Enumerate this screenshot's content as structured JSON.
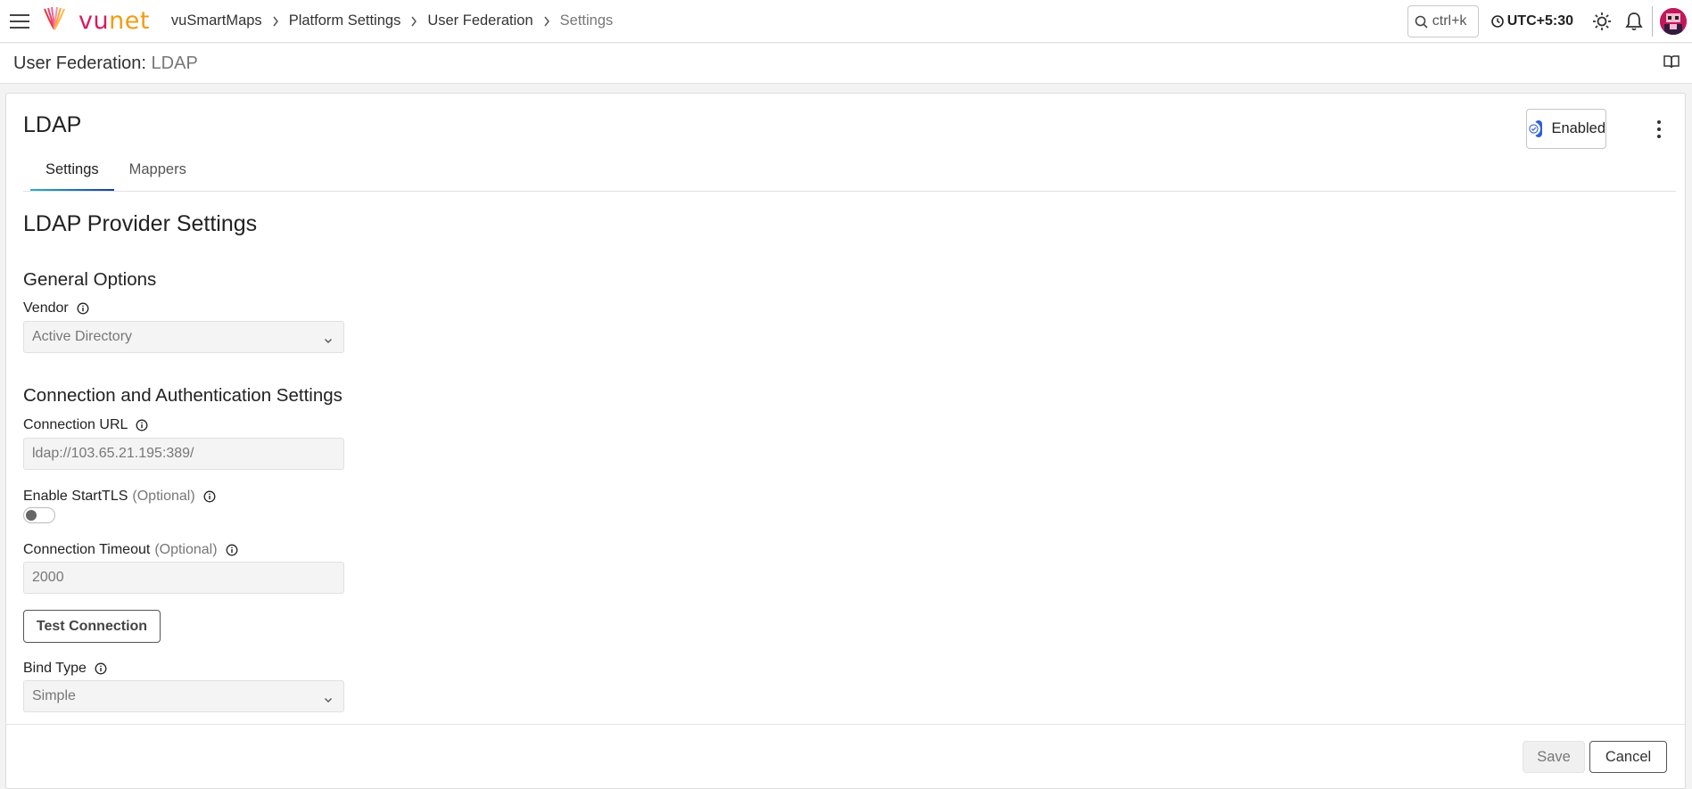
{
  "header": {
    "logo_vu": "vu",
    "logo_net": "net",
    "breadcrumb": [
      "vuSmartMaps",
      "Platform Settings",
      "User Federation",
      "Settings"
    ],
    "search_placeholder": "ctrl+k",
    "timezone": "UTC+5:30",
    "icons": [
      "hamburger-icon",
      "vunet-logo-icon",
      "search-icon",
      "clock-icon",
      "sun-icon",
      "bell-icon",
      "avatar-icon",
      "book-icon"
    ]
  },
  "page": {
    "title_prefix": "User Federation:",
    "title_value": "LDAP"
  },
  "card": {
    "title": "LDAP",
    "status_label": "Enabled",
    "status_enabled": true,
    "tabs": [
      {
        "label": "Settings",
        "active": true
      },
      {
        "label": "Mappers",
        "active": false
      }
    ]
  },
  "form": {
    "heading": "LDAP Provider Settings",
    "general_heading": "General Options",
    "vendor_label": "Vendor",
    "vendor_value": "Active Directory",
    "connection_heading": "Connection and Authentication Settings",
    "connection_url_label": "Connection URL",
    "connection_url_value": "ldap://103.65.21.195:389/",
    "starttls_label": "Enable StartTLS",
    "starttls_optional": "(Optional)",
    "starttls_enabled": false,
    "timeout_label": "Connection Timeout",
    "timeout_optional": "(Optional)",
    "timeout_value": "2000",
    "test_button": "Test Connection",
    "bind_type_label": "Bind Type",
    "bind_type_value": "Simple"
  },
  "footer": {
    "save_label": "Save",
    "cancel_label": "Cancel"
  },
  "colors": {
    "brand_pink": "#d81b60",
    "brand_orange": "#f39c12",
    "toggle_blue": "#2f5fd6",
    "tab_gradient_start": "#2bb0c7",
    "tab_gradient_end": "#1b3d9c"
  }
}
